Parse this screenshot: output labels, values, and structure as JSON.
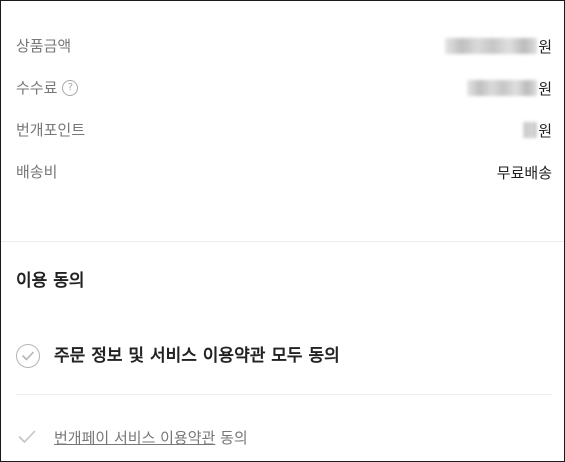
{
  "summary": {
    "product_amount": {
      "label": "상품금액",
      "unit": "원"
    },
    "fee": {
      "label": "수수료",
      "help_icon": "question-circle-icon",
      "unit": "원"
    },
    "points": {
      "label": "번개포인트",
      "unit": "원"
    },
    "shipping": {
      "label": "배송비",
      "value": "무료배송"
    }
  },
  "agreement": {
    "title": "이용 동의",
    "all": {
      "label": "주문 정보 및 서비스 이용약관 모두 동의",
      "icon": "check-circle-icon"
    },
    "item": {
      "link_text": "번개페이 서비스 이용약관",
      "suffix": " 동의",
      "icon": "check-icon"
    }
  }
}
